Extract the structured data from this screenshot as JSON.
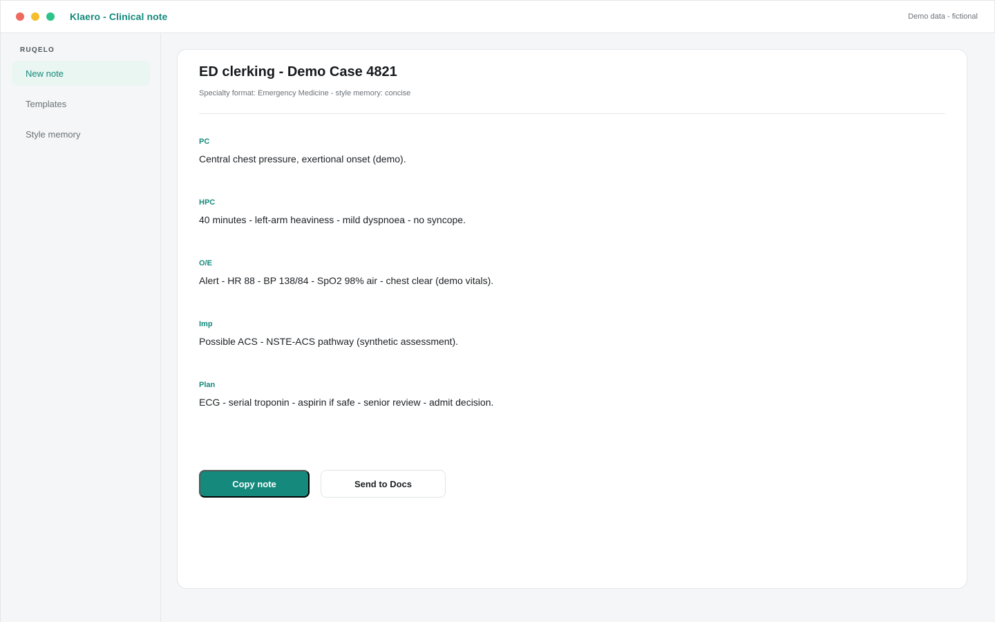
{
  "window": {
    "title": "Klaero - Clinical note",
    "demo_tag": "Demo data - fictional",
    "controls": [
      "close-icon",
      "minimize-icon",
      "zoom-icon"
    ]
  },
  "sidebar": {
    "brand": "RUQELO",
    "items": [
      {
        "label": "New note",
        "active": true
      },
      {
        "label": "Templates",
        "active": false
      },
      {
        "label": "Style memory",
        "active": false
      }
    ]
  },
  "note": {
    "title": "ED clerking - Demo Case 4821",
    "subtitle": "Specialty format: Emergency Medicine - style memory: concise",
    "sections": [
      {
        "label": "PC",
        "text": "Central chest pressure, exertional onset (demo)."
      },
      {
        "label": "HPC",
        "text": "40 minutes - left-arm heaviness - mild dyspnoea - no syncope."
      },
      {
        "label": "O/E",
        "text": "Alert - HR 88 - BP 138/84 - SpO2 98% air - chest clear (demo vitals)."
      },
      {
        "label": "Imp",
        "text": "Possible ACS - NSTE-ACS pathway (synthetic assessment)."
      },
      {
        "label": "Plan",
        "text": "ECG - serial troponin - aspirin if safe - senior review - admit decision."
      }
    ]
  },
  "actions": {
    "copy_label": "Copy note",
    "send_label": "Send to Docs"
  },
  "colors": {
    "accent": "#14897c",
    "accent_soft": "#e9f6f1",
    "traffic_red": "#ee6a5f",
    "traffic_yellow": "#f4bf2f",
    "traffic_green": "#2fc388"
  }
}
